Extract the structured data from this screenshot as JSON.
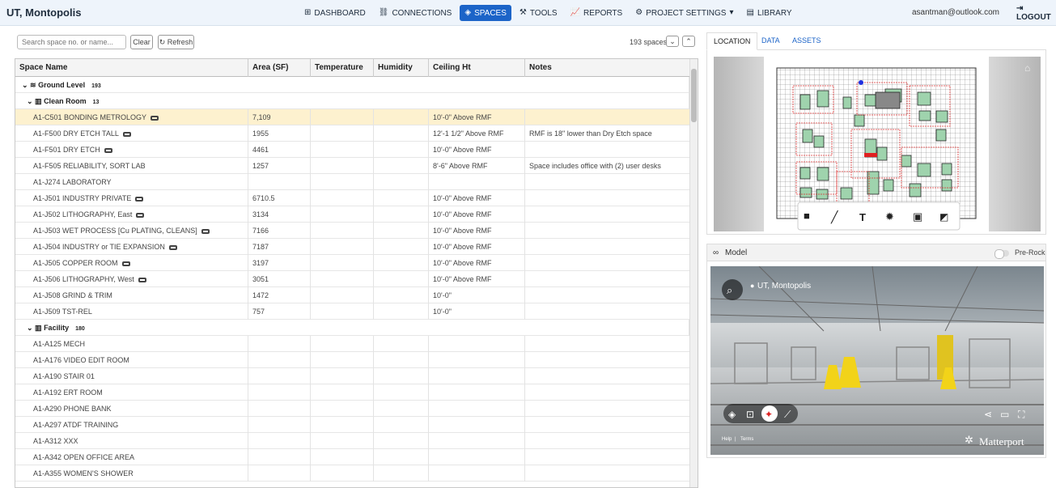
{
  "header": {
    "project": "UT, Montopolis",
    "user": "asantman@outlook.com",
    "logout": "LOGOUT",
    "nav": [
      {
        "label": "DASHBOARD",
        "icon": "⊞"
      },
      {
        "label": "CONNECTIONS",
        "icon": "⛓"
      },
      {
        "label": "SPACES",
        "icon": "◈"
      },
      {
        "label": "TOOLS",
        "icon": "⚒"
      },
      {
        "label": "REPORTS",
        "icon": "📈"
      },
      {
        "label": "PROJECT SETTINGS",
        "icon": "⚙"
      },
      {
        "label": "LIBRARY",
        "icon": "▤"
      }
    ]
  },
  "toolbar": {
    "search_placeholder": "Search space no. or name...",
    "clear": "Clear",
    "refresh": "Refresh",
    "count": "193 spaces"
  },
  "table": {
    "columns": [
      "Space Name",
      "Area (SF)",
      "Temperature",
      "Humidity",
      "Ceiling Ht",
      "Notes"
    ],
    "ground": {
      "label": "Ground Level",
      "count": "193"
    },
    "group1": {
      "label": "Clean Room",
      "count": "13"
    },
    "group2": {
      "label": "Facility",
      "count": "180"
    },
    "rows": [
      {
        "name": "A1-C501  BONDING METROLOGY",
        "area": "7,109",
        "temp": "",
        "hum": "",
        "ceil": "10'-0\" Above RMF",
        "notes": "",
        "model": true
      },
      {
        "name": "A1-F500  DRY ETCH TALL",
        "area": "1955",
        "temp": "",
        "hum": "",
        "ceil": "12'-1 1/2\" Above RMF",
        "notes": "RMF is 18\" lower than Dry Etch space",
        "model": true
      },
      {
        "name": "A1-F501  DRY ETCH",
        "area": "4461",
        "temp": "",
        "hum": "",
        "ceil": "10'-0\" Above RMF",
        "notes": "",
        "model": true
      },
      {
        "name": "A1-F505  RELIABILITY, SORT LAB",
        "area": "1257",
        "temp": "",
        "hum": "",
        "ceil": "8'-6\" Above RMF",
        "notes": "Space includes office with (2) user desks",
        "model": false
      },
      {
        "name": "A1-J274  LABORATORY",
        "area": "",
        "temp": "",
        "hum": "",
        "ceil": "",
        "notes": "",
        "model": false
      },
      {
        "name": "A1-J501  INDUSTRY PRIVATE",
        "area": "6710.5",
        "temp": "",
        "hum": "",
        "ceil": "10'-0\" Above RMF",
        "notes": "",
        "model": true
      },
      {
        "name": "A1-J502  LITHOGRAPHY, East",
        "area": "3134",
        "temp": "",
        "hum": "",
        "ceil": "10'-0\" Above RMF",
        "notes": "",
        "model": true
      },
      {
        "name": "A1-J503  WET PROCESS [Cu PLATING, CLEANS]",
        "area": "7166",
        "temp": "",
        "hum": "",
        "ceil": "10'-0\" Above RMF",
        "notes": "",
        "model": true
      },
      {
        "name": "A1-J504  INDUSTRY or TIE EXPANSION",
        "area": "7187",
        "temp": "",
        "hum": "",
        "ceil": "10'-0\" Above RMF",
        "notes": "",
        "model": true
      },
      {
        "name": "A1-J505  COPPER ROOM",
        "area": "3197",
        "temp": "",
        "hum": "",
        "ceil": "10'-0\" Above RMF",
        "notes": "",
        "model": true
      },
      {
        "name": "A1-J506  LITHOGRAPHY, West",
        "area": "3051",
        "temp": "",
        "hum": "",
        "ceil": "10'-0\" Above RMF",
        "notes": "",
        "model": true
      },
      {
        "name": "A1-J508  GRIND & TRIM",
        "area": "1472",
        "temp": "",
        "hum": "",
        "ceil": "10'-0\"",
        "notes": "",
        "model": false
      },
      {
        "name": "A1-J509  TST-REL",
        "area": "757",
        "temp": "",
        "hum": "",
        "ceil": "10'-0\"",
        "notes": "",
        "model": false
      }
    ],
    "facility_rows": [
      "A1-A125  MECH",
      "A1-A176  VIDEO EDIT ROOM",
      "A1-A190  STAIR 01",
      "A1-A192  ERT ROOM",
      "A1-A290  PHONE BANK",
      "A1-A297  ATDF TRAINING",
      "A1-A312  XXX",
      "A1-A342  OPEN OFFICE AREA",
      "A1-A355  WOMEN'S SHOWER"
    ]
  },
  "right": {
    "tabs": [
      "LOCATION",
      "DATA",
      "ASSETS"
    ],
    "model_title": "Model",
    "pre_rock": "Pre-Rock",
    "pano_location": "UT, Montopolis",
    "help": "Help",
    "terms": "Terms",
    "brand": "Matterport"
  }
}
